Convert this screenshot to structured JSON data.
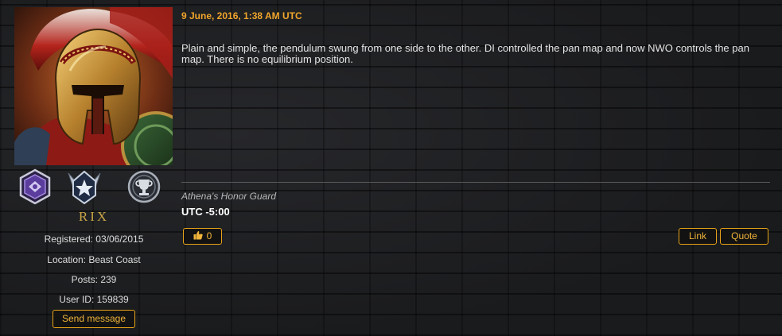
{
  "post": {
    "date": "9 June, 2016, 1:38 AM UTC",
    "body": "Plain and simple, the pendulum swung from one side to the other.  DI controlled the pan map and now NWO controls the pan map. There is no equilibrium position.",
    "signature_title": "Athena's Honor Guard",
    "signature_timezone": "UTC -5:00",
    "likes": "0",
    "link_label": "Link",
    "quote_label": "Quote"
  },
  "user": {
    "name": "RIX",
    "registered": "Registered: 03/06/2015",
    "location": "Location: Beast Coast",
    "posts": "Posts: 239",
    "user_id": "User ID: 159839",
    "send_message_label": "Send message"
  },
  "badges": [
    "purple-hexagon-rank-icon",
    "silver-star-wings-rank-icon",
    "trophy-rank-icon"
  ],
  "colors": {
    "accent": "#f0a52c",
    "button_border": "#e8a317",
    "username": "#c9a547",
    "background": "#1c1d1f"
  }
}
